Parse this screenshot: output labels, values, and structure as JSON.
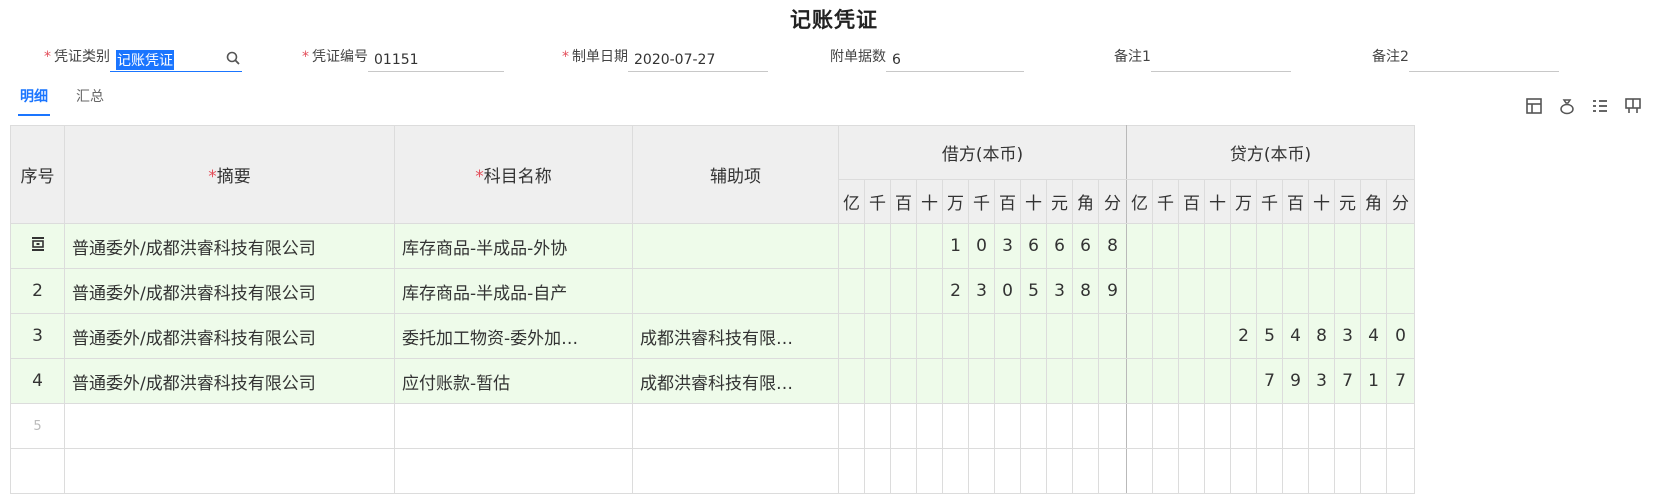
{
  "title": "记账凭证",
  "header": {
    "voucher_type": {
      "label": "凭证类别",
      "value": "记账凭证"
    },
    "voucher_no": {
      "label": "凭证编号",
      "value": "01151"
    },
    "date": {
      "label": "制单日期",
      "value": "2020-07-27"
    },
    "attachments": {
      "label": "附单据数",
      "value": "6"
    },
    "note1": {
      "label": "备注1",
      "value": ""
    },
    "note2": {
      "label": "备注2",
      "value": ""
    }
  },
  "tabs": [
    "明细",
    "汇总"
  ],
  "toolbar_icons": [
    "table-icon",
    "bag-icon",
    "list-icon",
    "layout-icon"
  ],
  "table": {
    "col_index": "序号",
    "col_summary": "摘要",
    "col_account": "科目名称",
    "col_aux": "辅助项",
    "debit_header": "借方(本币)",
    "credit_header": "贷方(本币)",
    "digit_units": [
      "亿",
      "千",
      "百",
      "十",
      "万",
      "千",
      "百",
      "十",
      "元",
      "角",
      "分"
    ],
    "rows": [
      {
        "index": "",
        "index_icon": "insert-row-icon",
        "summary": "普通委外/成都洪睿科技有限公司",
        "account": "库存商品-半成品-外协",
        "aux": "",
        "debit": [
          "",
          "",
          "",
          "",
          "1",
          "0",
          "3",
          "6",
          "6",
          "6",
          "8"
        ],
        "credit": [
          "",
          "",
          "",
          "",
          "",
          "",
          "",
          "",
          "",
          "",
          ""
        ]
      },
      {
        "index": "2",
        "summary": "普通委外/成都洪睿科技有限公司",
        "account": "库存商品-半成品-自产",
        "aux": "",
        "debit": [
          "",
          "",
          "",
          "",
          "2",
          "3",
          "0",
          "5",
          "3",
          "8",
          "9"
        ],
        "credit": [
          "",
          "",
          "",
          "",
          "",
          "",
          "",
          "",
          "",
          "",
          ""
        ]
      },
      {
        "index": "3",
        "summary": "普通委外/成都洪睿科技有限公司",
        "account": "委托加工物资-委外加…",
        "aux": "成都洪睿科技有限…",
        "debit": [
          "",
          "",
          "",
          "",
          "",
          "",
          "",
          "",
          "",
          "",
          ""
        ],
        "credit": [
          "",
          "",
          "",
          "",
          "2",
          "5",
          "4",
          "8",
          "3",
          "4",
          "0"
        ]
      },
      {
        "index": "4",
        "summary": "普通委外/成都洪睿科技有限公司",
        "account": "应付账款-暂估",
        "aux": "成都洪睿科技有限…",
        "debit": [
          "",
          "",
          "",
          "",
          "",
          "",
          "",
          "",
          "",
          "",
          ""
        ],
        "credit": [
          "",
          "",
          "",
          "",
          "",
          "7",
          "9",
          "3",
          "7",
          "1",
          "7"
        ]
      }
    ],
    "empty_rows": [
      "5",
      ""
    ]
  }
}
